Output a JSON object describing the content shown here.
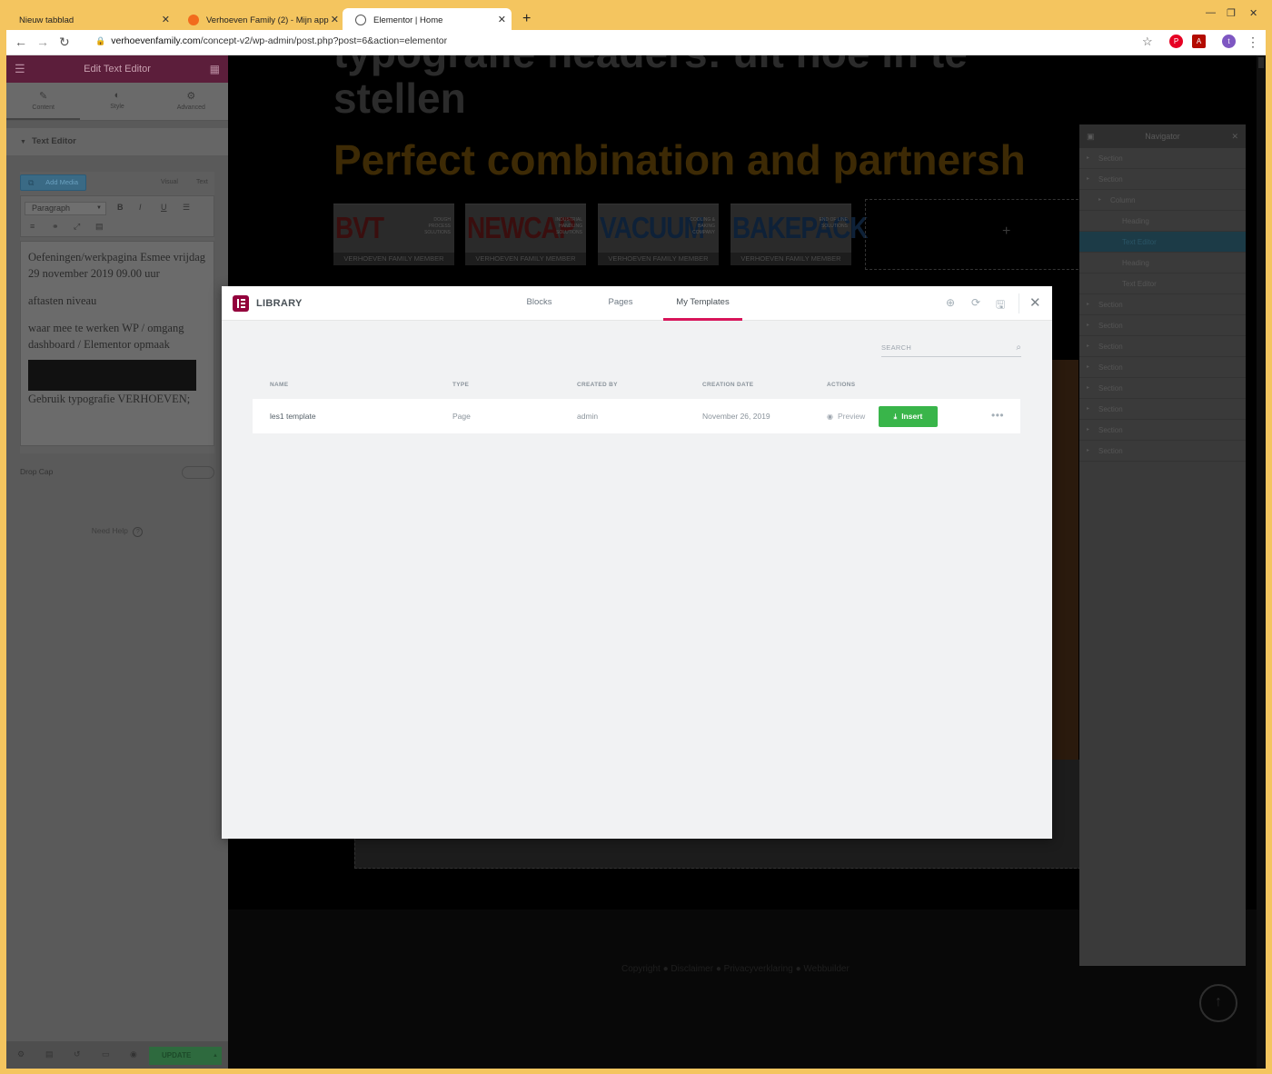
{
  "browser": {
    "tabs": [
      {
        "title": "Nieuw tabblad"
      },
      {
        "title": "Verhoeven Family (2) - Mijn app"
      },
      {
        "title": "Elementor | Home"
      }
    ],
    "url_host": "verhoevenfamily.com",
    "url_path": "/concept-v2/wp-admin/post.php?post=6&action=elementor",
    "profile_initial": "t"
  },
  "panel": {
    "title": "Edit Text Editor",
    "tabs": [
      {
        "label": "Content"
      },
      {
        "label": "Style"
      },
      {
        "label": "Advanced"
      }
    ],
    "section_title": "Text Editor",
    "add_media": "Add Media",
    "visual_label": "Visual",
    "text_label": "Text",
    "format_select": "Paragraph",
    "editor_paragraphs": [
      "Oefeningen/werkpagina Esmee vrijdag 29 november 2019 09.00 uur",
      "aftasten niveau",
      "waar mee te werken WP / omgang dashboard / Elementor opmaak",
      "Gebruik typografie VERHOEVEN;"
    ],
    "drop_cap_label": "Drop Cap",
    "need_help": "Need Help",
    "update_label": "UPDATE"
  },
  "canvas": {
    "heading_line1": "typografie headers: uit hoe in te",
    "heading_line2": "stellen",
    "subheading": "Perfect combination and partnersh",
    "logos": [
      {
        "name": "BVT",
        "tag": "DOUGH PROCESS SOLUTIONS",
        "band": "VERHOEVEN FAMILY MEMBER"
      },
      {
        "name": "NEWCAP",
        "tag": "INDUSTRIAL HANDLING SOLUTIONS",
        "band": "VERHOEVEN FAMILY MEMBER"
      },
      {
        "name": "VACUUM",
        "tag": "COOLING & BAKING COMPANY",
        "band": "VERHOEVEN FAMILY MEMBER"
      },
      {
        "name": "BAKEPACK",
        "tag": "END OF LINE SOLUTIONS",
        "band": "VERHOEVEN FAMILY MEMBER"
      }
    ],
    "add_placeholder": "+",
    "footer_text": "Copyright ● Disclaimer ● Privacyverklaring ● Webbuilder"
  },
  "navigator": {
    "title": "Navigator",
    "items": [
      {
        "label": "Section",
        "level": 0
      },
      {
        "label": "Section",
        "level": 0
      },
      {
        "label": "Column",
        "level": 1
      },
      {
        "label": "Heading",
        "level": 2
      },
      {
        "label": "Text Editor",
        "level": 2,
        "active": true
      },
      {
        "label": "Heading",
        "level": 2
      },
      {
        "label": "Text Editor",
        "level": 2
      },
      {
        "label": "Section",
        "level": 0
      },
      {
        "label": "Section",
        "level": 0
      },
      {
        "label": "Section",
        "level": 0
      },
      {
        "label": "Section",
        "level": 0
      },
      {
        "label": "Section",
        "level": 0
      },
      {
        "label": "Section",
        "level": 0
      },
      {
        "label": "Section",
        "level": 0
      },
      {
        "label": "Section",
        "level": 0
      }
    ]
  },
  "library": {
    "title": "LIBRARY",
    "tabs": [
      {
        "label": "Blocks"
      },
      {
        "label": "Pages"
      },
      {
        "label": "My Templates",
        "active": true
      }
    ],
    "search_placeholder": "SEARCH",
    "columns": [
      "NAME",
      "TYPE",
      "CREATED BY",
      "CREATION DATE",
      "ACTIONS"
    ],
    "rows": [
      {
        "name": "les1 template",
        "type": "Page",
        "created_by": "admin",
        "date": "November 26, 2019",
        "preview": "Preview",
        "insert": "Insert"
      }
    ],
    "accent_color": "#d8155a",
    "insert_color": "#39b54a"
  }
}
